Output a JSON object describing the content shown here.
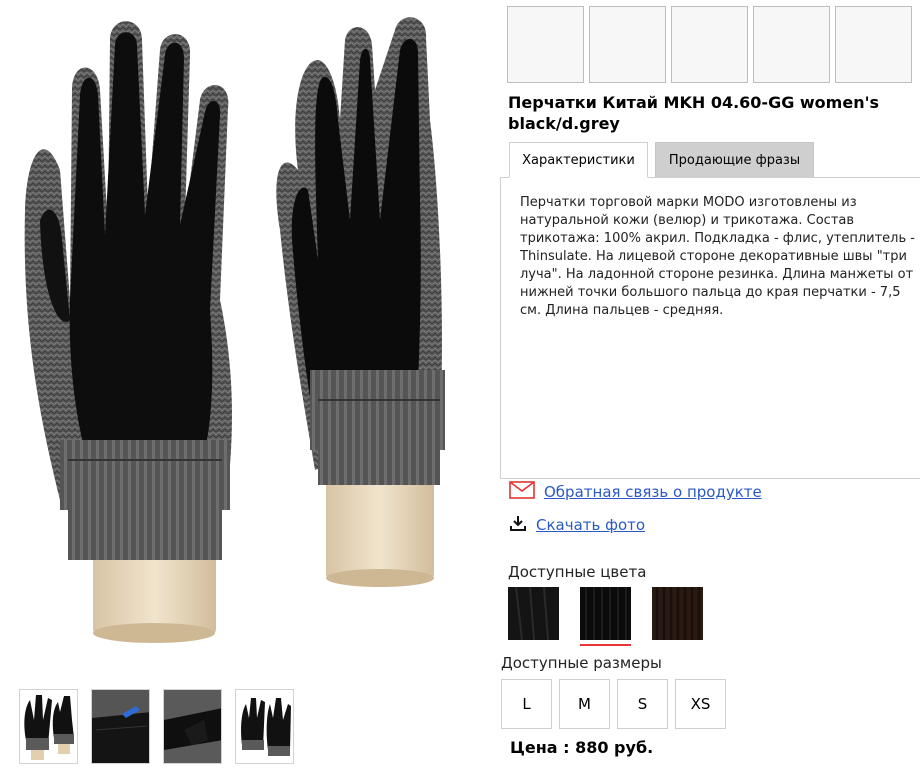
{
  "product": {
    "title": "Перчатки Китай MKH 04.60-GG women's black/d.grey",
    "description": "Перчатки торговой марки MODO изготовлены из натуральной кожи (велюр) и трикотажа. Состав трикотажа: 100% акрил. Подкладка - флис, утеплитель - Thinsulate. На лицевой стороне декоративные швы \"три луча\". На ладонной стороне резинка. Длина манжеты от нижней точки большого пальца до края перчатки - 7,5 см. Длина пальцев - средняя.",
    "price": "Цена : 880 руб."
  },
  "tabs": [
    {
      "label": "Характеристики",
      "active": true
    },
    {
      "label": "Продающие фразы",
      "active": false
    }
  ],
  "links": {
    "feedback": {
      "label": "Обратная связь о продукте",
      "icon": "mail-icon"
    },
    "download": {
      "label": "Скачать фото",
      "icon": "download-icon"
    }
  },
  "colors": {
    "label": "Доступные цвета",
    "items": [
      {
        "name": "black",
        "hex": "#141414",
        "selected": false
      },
      {
        "name": "black-knit",
        "hex": "#0b0b0b",
        "selected": true
      },
      {
        "name": "dark-brown",
        "hex": "#2a1a14",
        "selected": false
      }
    ],
    "accent": "#e33333"
  },
  "sizes": {
    "label": "Доступные размеры",
    "items": [
      "L",
      "M",
      "S",
      "XS"
    ]
  },
  "style": {
    "link_color": "#2a59c6",
    "tab_inactive_bg": "#cfcfcf"
  }
}
